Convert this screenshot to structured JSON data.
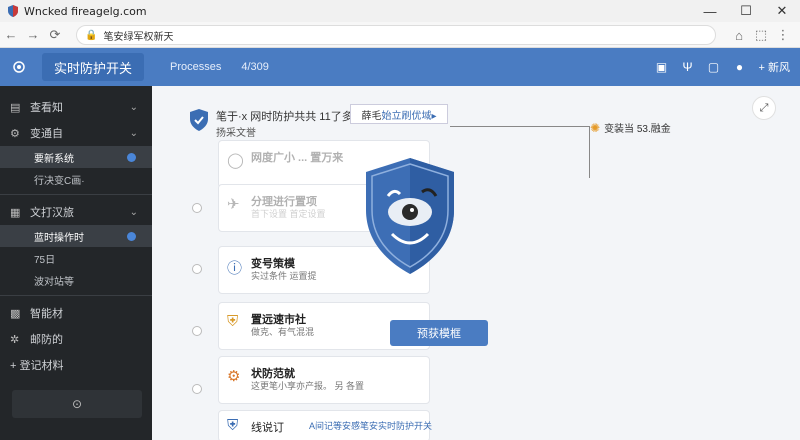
{
  "browser": {
    "tab_title": "Wncked fireagelg.com",
    "url": "笔安绿军权新天",
    "window_controls": [
      "minimize",
      "maximize",
      "close"
    ]
  },
  "app": {
    "switch_label": "实时防护开关",
    "tab_processes": "Processes",
    "count": "4/309",
    "new_label": "+ 新风",
    "icons": [
      "screen-icon",
      "antenna-icon",
      "chat-icon",
      "info-icon"
    ]
  },
  "sidebar": {
    "items": [
      {
        "label": "查看知",
        "icon": "monitor-icon"
      },
      {
        "label": "变通自",
        "icon": "gear-icon"
      }
    ],
    "sub1": [
      {
        "label": "要新系统",
        "active": true
      },
      {
        "label": "行决变C画·",
        "active": false
      }
    ],
    "item3": {
      "label": "文打汉旅",
      "icon": "document-icon"
    },
    "sub2": [
      {
        "label": "蓝时操作时",
        "active": true
      },
      {
        "label": "75日",
        "active": false
      },
      {
        "label": "波对站等",
        "active": false
      }
    ],
    "item4": {
      "label": "智能材",
      "icon": "grid-icon"
    },
    "item5": {
      "label": "邮防的",
      "icon": "cog-icon"
    },
    "item6": {
      "label": "+ 登记材料",
      "icon": "plus-icon"
    }
  },
  "main": {
    "header_title": "笔于·x 网时防护共共 11了多",
    "header_sub": "扬采文誉",
    "dropdown_text": "薛毛",
    "dropdown_blue": "始立刷优域▸",
    "callout_text": "变装当 53.融金",
    "cta_label": "预获模框",
    "cards": [
      {
        "title": "网度广小 ... 置万来",
        "desc": "",
        "faded": true
      },
      {
        "title": "分理进行置项",
        "desc": "首下设置 首定设置",
        "faded": true
      },
      {
        "title": "变号策模",
        "desc": "实过条件 运置提",
        "faded": false
      },
      {
        "title": "置远速市社",
        "desc": "做克、有气混混",
        "faded": false
      },
      {
        "title": "状防范就",
        "desc": "这更笔小享亦产报。 另 各置",
        "faded": false
      },
      {
        "title": "线说订",
        "desc": "A间记等安感笔安实时防护开关",
        "faded": false
      }
    ]
  },
  "colors": {
    "accent": "#4a7cc2",
    "sidebar_bg": "#232629"
  }
}
